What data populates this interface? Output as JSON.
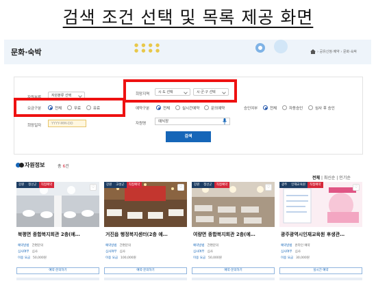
{
  "heading": "검색 조건 선택 및 목록 제공 화면",
  "banner": {
    "title": "문화·숙박",
    "breadcrumb": "› 공유신청·예약 › 문화·숙박"
  },
  "filters": {
    "region_label": "희망지역",
    "region_sido": "시·도 선택",
    "region_sigungu": "시·군·구 선택",
    "category_label": "자원분류",
    "category_value": "자원분류 선택",
    "fee_label": "요금구분",
    "fee_options": [
      "전체",
      "무료",
      "유료"
    ],
    "reserve_label": "예약구분",
    "reserve_options": [
      "전체",
      "실시간예약",
      "문의예약"
    ],
    "approval_label": "승인여부",
    "approval_options": [
      "전체",
      "자동승인",
      "심사 후 승인"
    ],
    "date_label": "희망일자",
    "date_placeholder": "YYYY-MM-DD",
    "name_label": "자원명",
    "name_value": "예식장",
    "search_button": "검색"
  },
  "results": {
    "title": "자원정보",
    "count_prefix": "총",
    "count": "6",
    "count_suffix": "건",
    "sort_all": "전체",
    "sort_latest": "최신순",
    "sort_popular": "인기순"
  },
  "cards": [
    {
      "tags": [
        "강원",
        "정선군",
        "직접예약"
      ],
      "name": "북평면 종합복지회관 2층(예…",
      "meta": [
        [
          "예약방법",
          "간편문의"
        ],
        [
          "심사여부",
          "심사"
        ],
        [
          "이용 요금",
          "50,000원"
        ]
      ],
      "button": "예약·문의하기"
    },
    {
      "tags": [
        "강원",
        "고성군",
        "직접예약"
      ],
      "name": "거진읍 행정복지센터(2층 예…",
      "meta": [
        [
          "예약방법",
          "간편문의"
        ],
        [
          "심사여부",
          "심사"
        ],
        [
          "이용 요금",
          "100,000원"
        ]
      ],
      "button": "예약·문의하기"
    },
    {
      "tags": [
        "강원",
        "정선군",
        "직접예약"
      ],
      "name": "여량면 종합복지회관 2층(예…",
      "meta": [
        [
          "예약방법",
          "간편문의"
        ],
        [
          "심사여부",
          "심사"
        ],
        [
          "이용 요금",
          "50,000원"
        ]
      ],
      "button": "예약·문의하기"
    },
    {
      "tags": [
        "광주",
        "인재교육원",
        "직접예약"
      ],
      "name": "광주광역시인재교육원 후생관…",
      "meta": [
        [
          "예약방법",
          "온라인 예약"
        ],
        [
          "심사여부",
          "심사"
        ],
        [
          "이용 요금",
          "30,000원"
        ]
      ],
      "button": "실시간 예약"
    }
  ]
}
